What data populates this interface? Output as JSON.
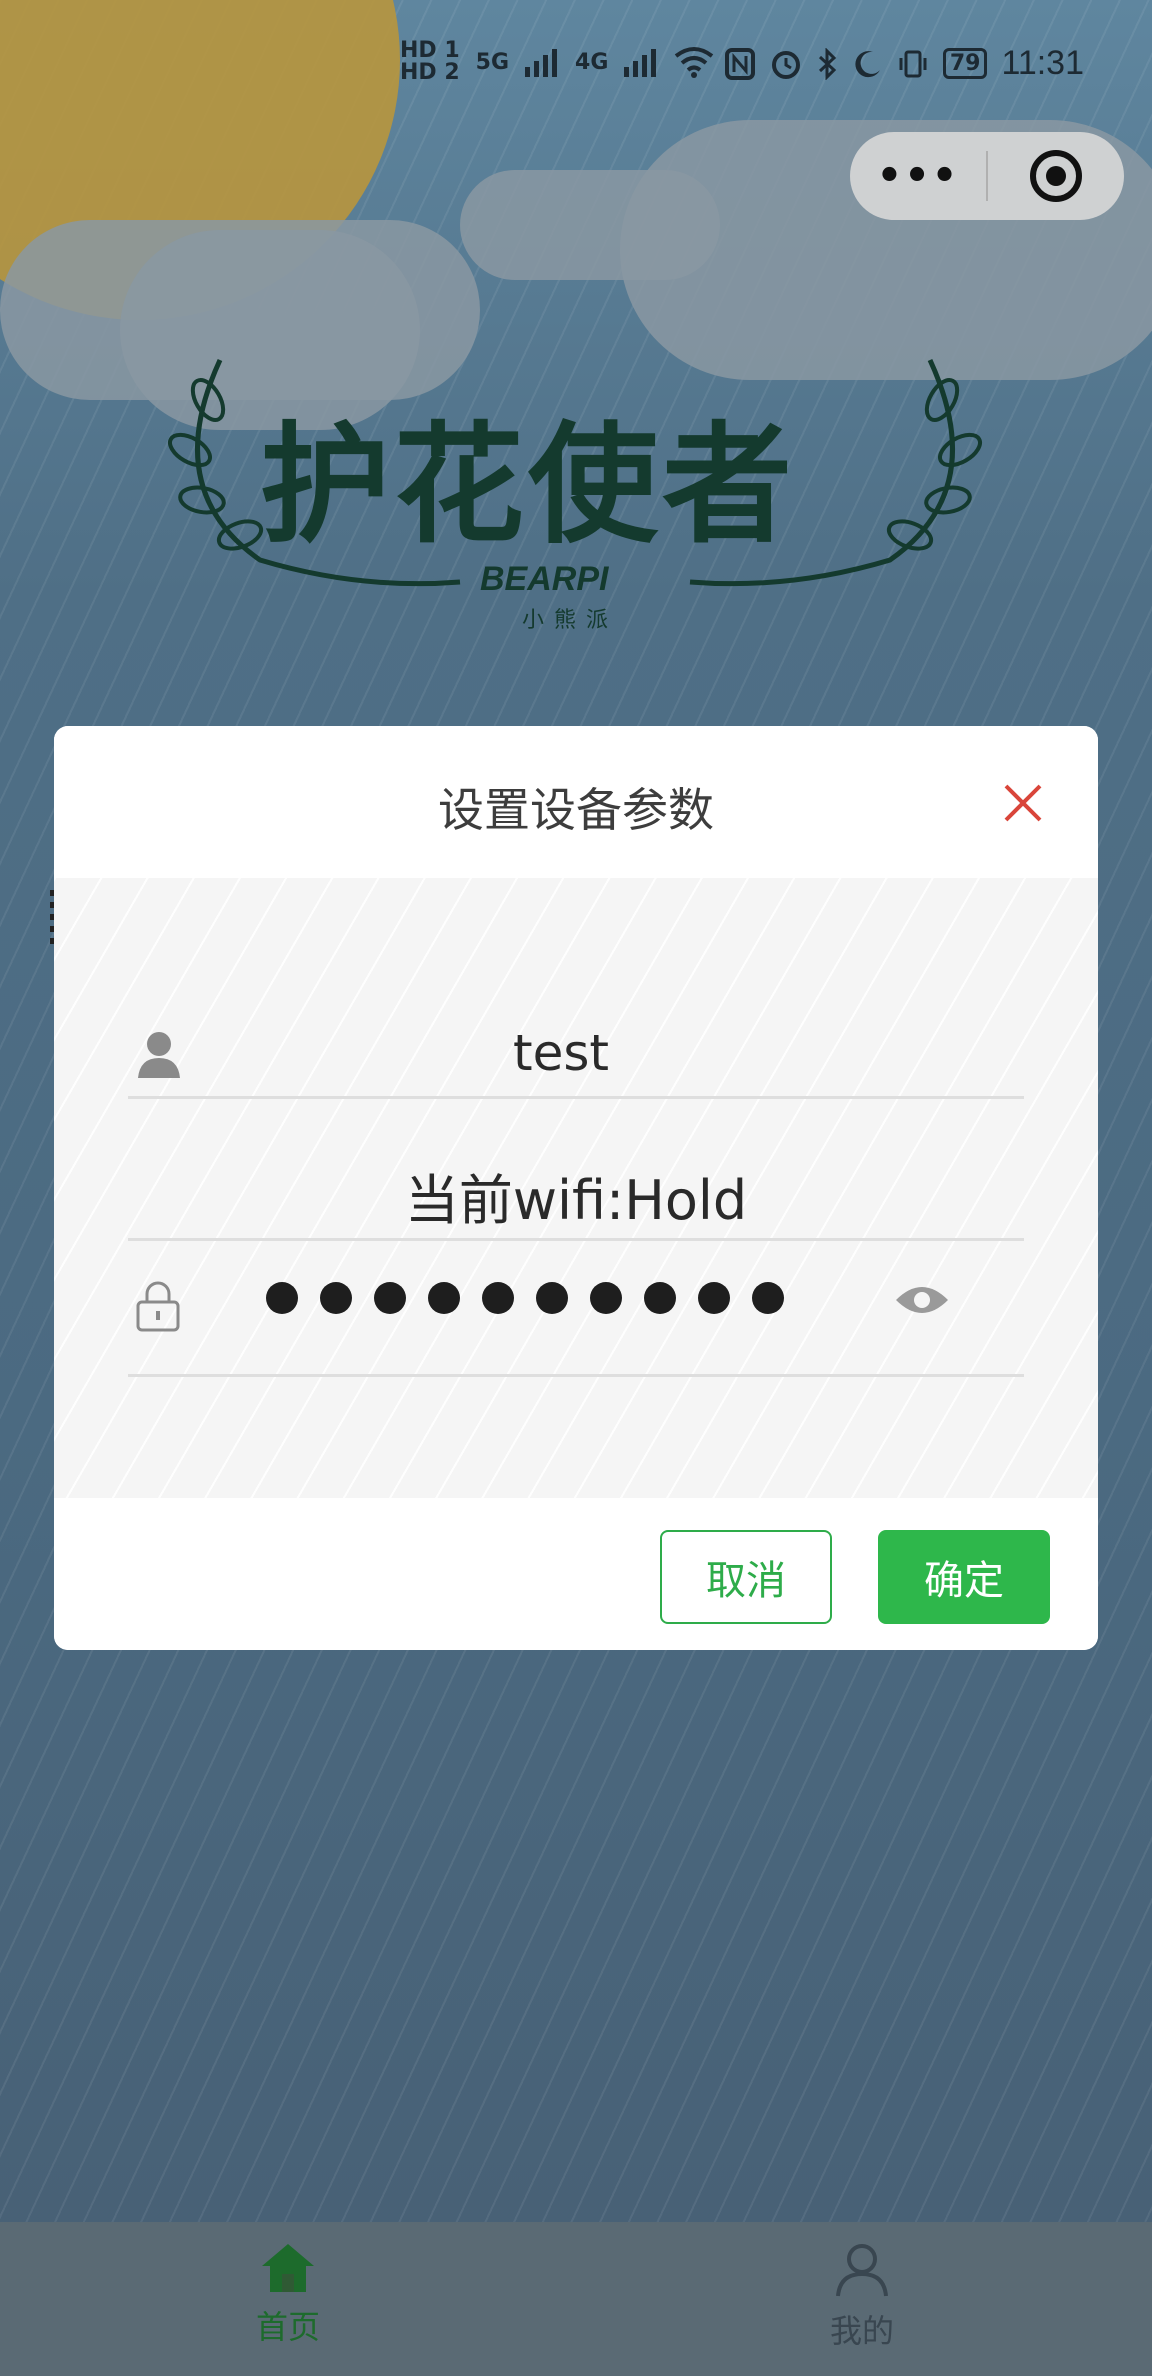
{
  "status_bar": {
    "sim1": "HD 1",
    "sim2": "HD 2",
    "network1": "5G",
    "network2": "4G",
    "battery": "79",
    "time": "11:31"
  },
  "capsule": {
    "more_label": "•••"
  },
  "logo": {
    "title": "护花使者",
    "brand": "BEARPI",
    "brand_sub": "小熊派"
  },
  "modal": {
    "title": "设置设备参数",
    "username_value": "test",
    "wifi_label": "当前wifi:Hold",
    "password_dot_count": 10,
    "cancel_label": "取消",
    "confirm_label": "确定"
  },
  "tabbar": {
    "tabs": [
      {
        "label": "首页",
        "icon": "home-icon",
        "active": true
      },
      {
        "label": "我的",
        "icon": "user-icon",
        "active": false
      }
    ]
  },
  "colors": {
    "accent_green": "#2eb74b",
    "close_red": "#d9453a",
    "logo_green": "#143a2e"
  }
}
